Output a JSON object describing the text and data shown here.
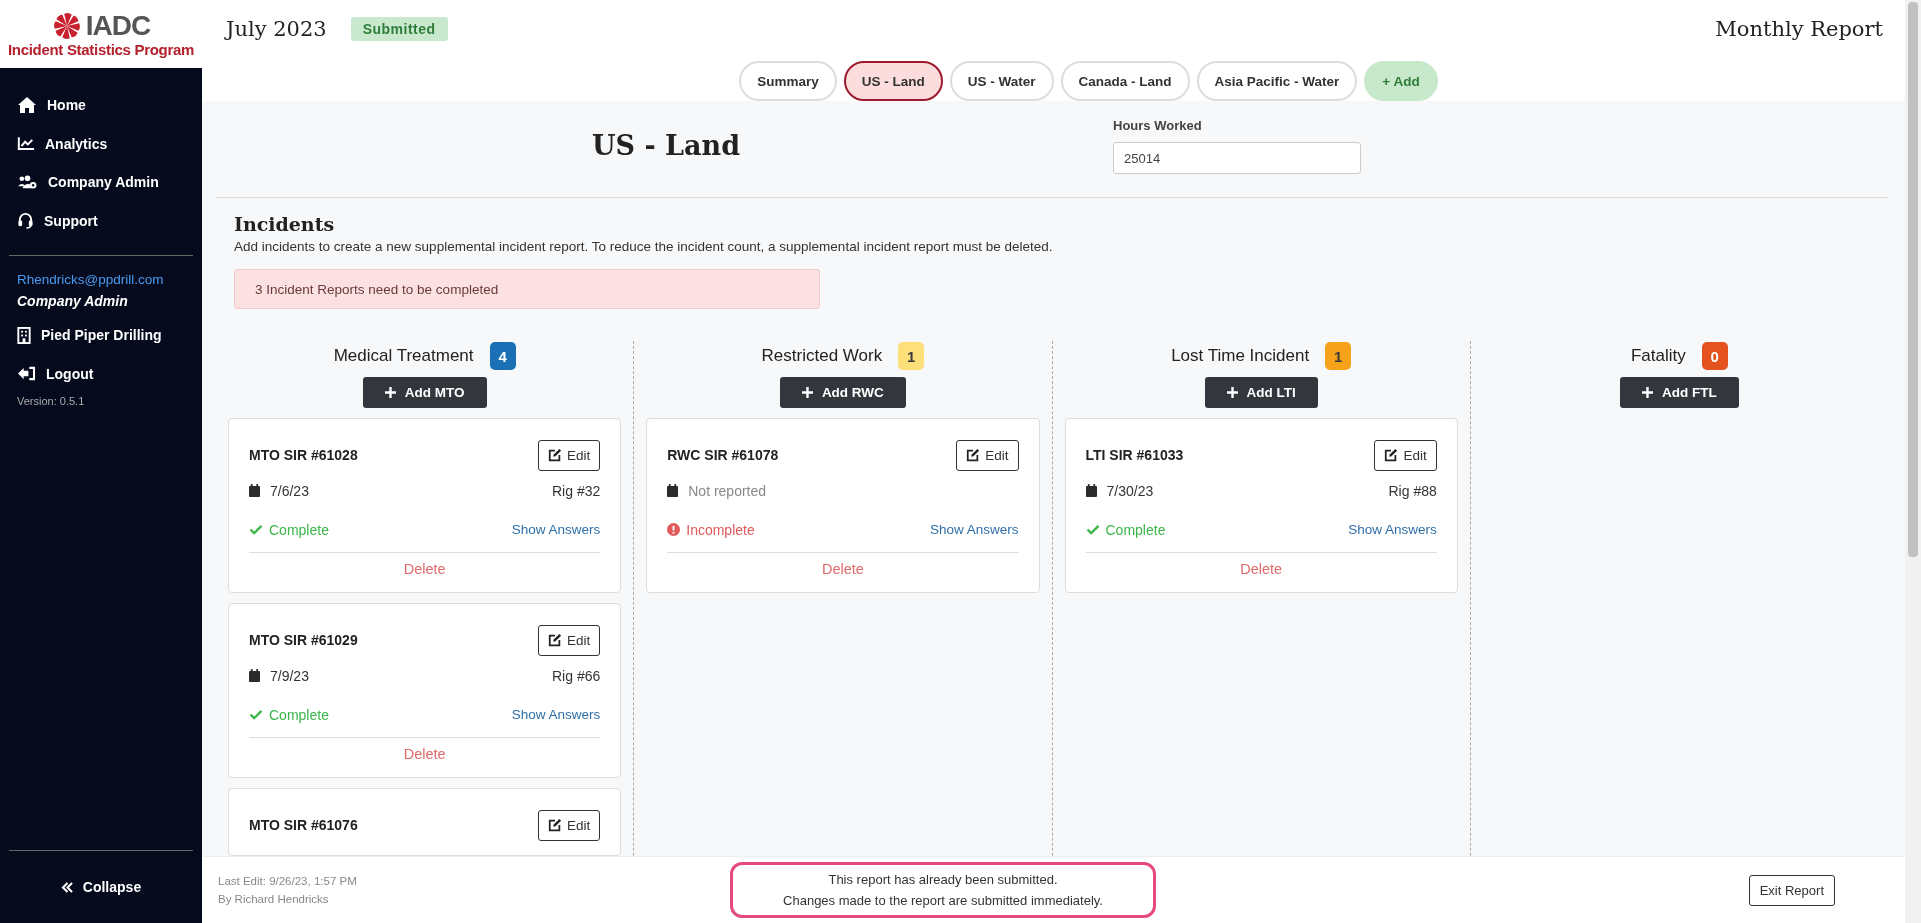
{
  "sidebar": {
    "logo": {
      "title": "IADC",
      "subtitle": "Incident Statistics Program"
    },
    "nav": [
      {
        "label": "Home"
      },
      {
        "label": "Analytics"
      },
      {
        "label": "Company Admin"
      },
      {
        "label": "Support"
      }
    ],
    "user": {
      "email": "Rhendricks@ppdrill.com",
      "role": "Company Admin",
      "company": "Pied Piper Drilling"
    },
    "logout": "Logout",
    "version": "Version: 0.5.1",
    "collapse": "Collapse"
  },
  "header": {
    "period": "July 2023",
    "status": "Submitted",
    "report_title": "Monthly Report"
  },
  "tabs": [
    {
      "label": "Summary",
      "selected": false
    },
    {
      "label": "US - Land",
      "selected": true
    },
    {
      "label": "US - Water",
      "selected": false
    },
    {
      "label": "Canada - Land",
      "selected": false
    },
    {
      "label": "Asia Pacific - Water",
      "selected": false
    }
  ],
  "add_tab": "+ Add",
  "region": {
    "title": "US - Land",
    "hours_label": "Hours Worked",
    "hours_value": "25014"
  },
  "incidents": {
    "title": "Incidents",
    "description": "Add incidents to create a new supplemental incident report. To reduce the incident count, a supplemental incident report must be deleted.",
    "alert": "3 Incident Reports need to be completed"
  },
  "columns": [
    {
      "title": "Medical Treatment",
      "count": "4",
      "color": "#1a6fb5",
      "add_label": "Add MTO",
      "cards": [
        {
          "title": "MTO SIR #61028",
          "edit": "Edit",
          "date": "7/6/23",
          "date_reported": true,
          "rig": "Rig #32",
          "status": "Complete",
          "complete": true,
          "answers": "Show Answers",
          "delete": "Delete"
        },
        {
          "title": "MTO SIR #61029",
          "edit": "Edit",
          "date": "7/9/23",
          "date_reported": true,
          "rig": "Rig #66",
          "status": "Complete",
          "complete": true,
          "answers": "Show Answers",
          "delete": "Delete"
        },
        {
          "title": "MTO SIR #61076",
          "edit": "Edit"
        }
      ]
    },
    {
      "title": "Restricted Work",
      "count": "1",
      "color": "#fde07a",
      "add_label": "Add RWC",
      "cards": [
        {
          "title": "RWC SIR #61078",
          "edit": "Edit",
          "date": "Not reported",
          "date_reported": false,
          "status": "Incomplete",
          "complete": false,
          "answers": "Show Answers",
          "delete": "Delete"
        }
      ]
    },
    {
      "title": "Lost Time Incident",
      "count": "1",
      "color": "#f7a21b",
      "add_label": "Add LTI",
      "cards": [
        {
          "title": "LTI SIR #61033",
          "edit": "Edit",
          "date": "7/30/23",
          "date_reported": true,
          "rig": "Rig #88",
          "status": "Complete",
          "complete": true,
          "answers": "Show Answers",
          "delete": "Delete"
        }
      ]
    },
    {
      "title": "Fatality",
      "count": "0",
      "color": "#e4531f",
      "add_label": "Add FTL"
    }
  ],
  "footer": {
    "last_edit": "Last Edit: 9/26/23, 1:57 PM",
    "editor": "By Richard Hendricks",
    "notice": [
      "This report has already been submitted.",
      "Changes made to the report are submitted immediately."
    ],
    "exit": "Exit Report"
  }
}
